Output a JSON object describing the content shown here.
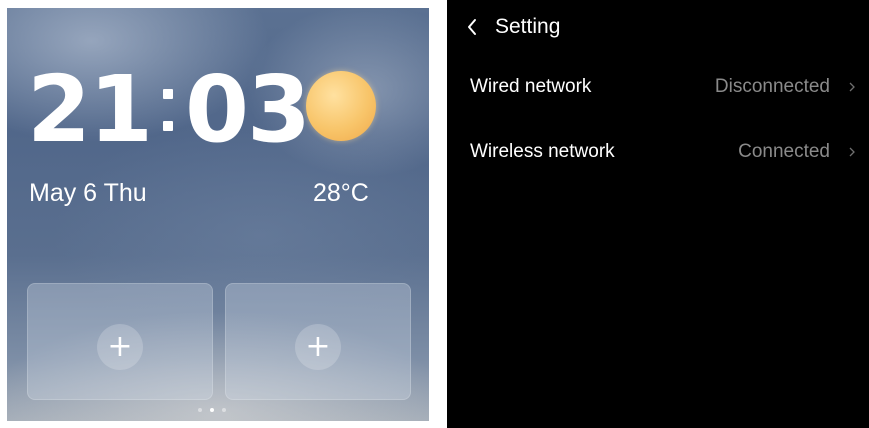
{
  "home": {
    "time_hours": "21",
    "time_minutes": "03",
    "date": "May 6 Thu",
    "temperature": "28°C",
    "weather_icon": "sun-icon",
    "cards": [
      {
        "add_label": "+"
      },
      {
        "add_label": "+"
      }
    ],
    "pager": {
      "count": 3,
      "active_index": 1
    }
  },
  "settings": {
    "back_icon": "chevron-left-icon",
    "title": "Setting",
    "items": [
      {
        "label": "Wired network",
        "value": "Disconnected",
        "icon": "chevron-right-icon"
      },
      {
        "label": "Wireless network",
        "value": "Connected",
        "icon": "chevron-right-icon"
      }
    ]
  },
  "colors": {
    "settings_background": "#000000",
    "value_text": "#8a8a8a",
    "sun": "#f8c56a"
  }
}
